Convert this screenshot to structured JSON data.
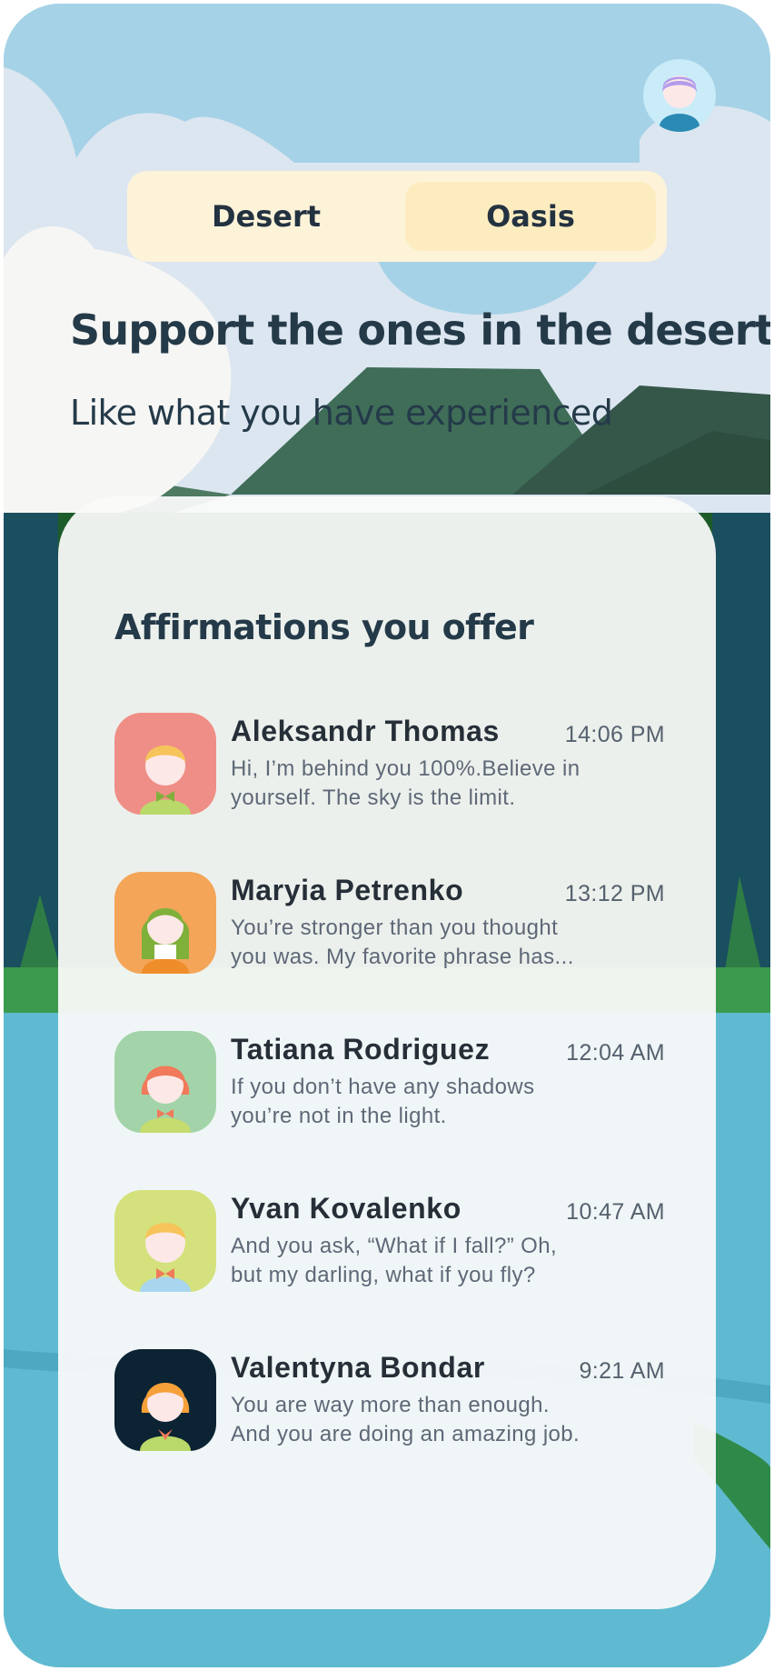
{
  "tabs": [
    {
      "label": "Desert",
      "selected": false
    },
    {
      "label": "Oasis",
      "selected": true
    }
  ],
  "headline": "Support the ones in the desert",
  "subline": "Like what you have experienced",
  "card": {
    "title": "Affirmations you offer",
    "messages": [
      {
        "name": "Aleksandr Thomas",
        "time": "14:06 PM",
        "line1": "Hi, I’m behind you 100%.Believe in",
        "line2": "yourself. The sky is the limit.",
        "avatar_bg": "#ef8e86"
      },
      {
        "name": "Maryia Petrenko",
        "time": "13:12 PM",
        "line1": "You’re stronger than you thought",
        "line2": "you was. My favorite phrase has...",
        "avatar_bg": "#f4a558"
      },
      {
        "name": "Tatiana Rodriguez",
        "time": "12:04 AM",
        "line1": "If you don’t have any shadows",
        "line2": "you’re not in the light.",
        "avatar_bg": "#a3d4a9"
      },
      {
        "name": "Yvan Kovalenko",
        "time": "10:47 AM",
        "line1": "And you ask, “What if I fall?” Oh,",
        "line2": "but my darling, what if you fly?",
        "avatar_bg": "#d4e17c"
      },
      {
        "name": "Valentyna Bondar",
        "time": "9:21 AM",
        "line1": "You are way more than enough.",
        "line2": "And you are doing an amazing job.",
        "avatar_bg": "#0b2332"
      }
    ]
  },
  "colors": {
    "sky": "#a6d2e7",
    "cloud": "#dce6f0",
    "mountain": "#3f6d58",
    "forest": "#1d5b2a",
    "water": "#5fbad1",
    "tab_bar": "#fdf3d9",
    "tab_selected": "#fdecbf",
    "heading": "#243a49"
  }
}
